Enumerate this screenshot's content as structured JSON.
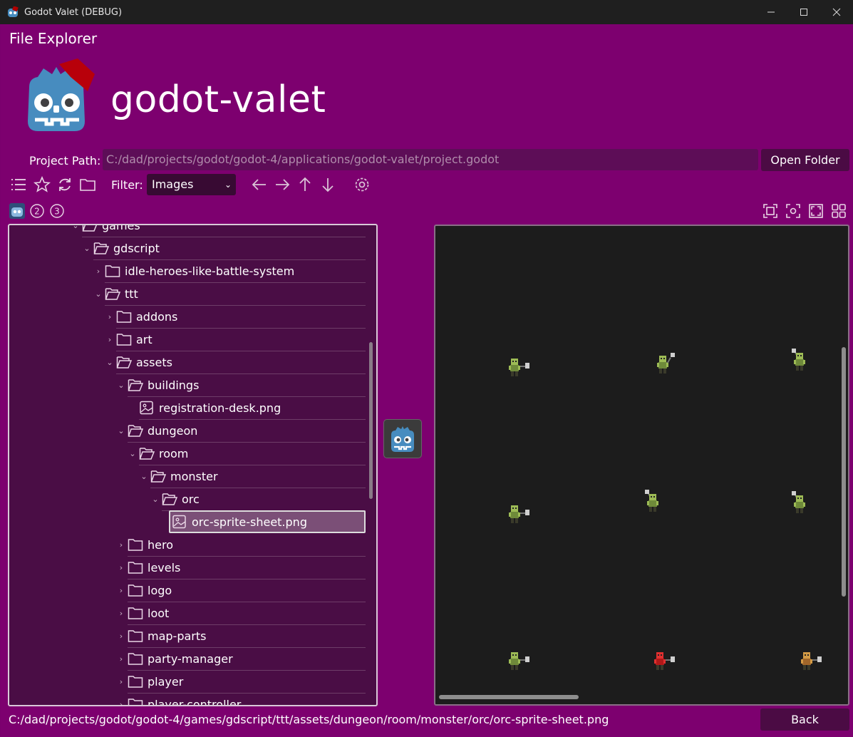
{
  "window": {
    "title": "Godot Valet (DEBUG)"
  },
  "header": {
    "section_title": "File Explorer",
    "app_name": "godot-valet"
  },
  "project": {
    "path_label": "Project Path:",
    "path_value": "C:/dad/projects/godot/godot-4/applications/godot-valet/project.godot",
    "open_folder_label": "Open Folder"
  },
  "toolbar": {
    "icons": [
      "list-icon",
      "star-icon",
      "refresh-icon",
      "folder-icon",
      "arrow-left-icon",
      "arrow-right-icon",
      "arrow-up-icon",
      "arrow-down-icon",
      "settings-icon"
    ],
    "filter_label": "Filter:",
    "filter_value": "Images"
  },
  "tabs": [
    "godot-icon",
    "2",
    "3"
  ],
  "tree": {
    "items": [
      {
        "label": "games",
        "depth": 5,
        "expanded": true,
        "type": "folder"
      },
      {
        "label": "gdscript",
        "depth": 6,
        "expanded": true,
        "type": "folder"
      },
      {
        "label": "idle-heroes-like-battle-system",
        "depth": 7,
        "expanded": false,
        "type": "folder"
      },
      {
        "label": "ttt",
        "depth": 7,
        "expanded": true,
        "type": "folder"
      },
      {
        "label": "addons",
        "depth": 8,
        "expanded": false,
        "type": "folder"
      },
      {
        "label": "art",
        "depth": 8,
        "expanded": false,
        "type": "folder"
      },
      {
        "label": "assets",
        "depth": 8,
        "expanded": true,
        "type": "folder"
      },
      {
        "label": "buildings",
        "depth": 9,
        "expanded": true,
        "type": "folder"
      },
      {
        "label": "registration-desk.png",
        "depth": 10,
        "type": "image"
      },
      {
        "label": "dungeon",
        "depth": 9,
        "expanded": true,
        "type": "folder"
      },
      {
        "label": "room",
        "depth": 10,
        "expanded": true,
        "type": "folder"
      },
      {
        "label": "monster",
        "depth": 11,
        "expanded": true,
        "type": "folder"
      },
      {
        "label": "orc",
        "depth": 12,
        "expanded": true,
        "type": "folder"
      },
      {
        "label": "orc-sprite-sheet.png",
        "depth": 13,
        "type": "image",
        "selected": true
      },
      {
        "label": "hero",
        "depth": 9,
        "expanded": false,
        "type": "folder"
      },
      {
        "label": "levels",
        "depth": 9,
        "expanded": false,
        "type": "folder"
      },
      {
        "label": "logo",
        "depth": 9,
        "expanded": false,
        "type": "folder"
      },
      {
        "label": "loot",
        "depth": 9,
        "expanded": false,
        "type": "folder"
      },
      {
        "label": "map-parts",
        "depth": 9,
        "expanded": false,
        "type": "folder"
      },
      {
        "label": "party-manager",
        "depth": 9,
        "expanded": false,
        "type": "folder"
      },
      {
        "label": "player",
        "depth": 9,
        "expanded": false,
        "type": "folder"
      },
      {
        "label": "player-controller",
        "depth": 9,
        "expanded": false,
        "type": "folder"
      }
    ]
  },
  "viewer_tools": [
    "fit-icon",
    "zoom-fit-icon",
    "fullscreen-icon",
    "grid-icon"
  ],
  "status": {
    "path": "C:/dad/projects/godot/godot-4/games/gdscript/ttt/assets/dungeon/room/monster/orc/orc-sprite-sheet.png",
    "back_label": "Back"
  },
  "colors": {
    "background": "#7d006f",
    "tree_bg": "#4a0d45",
    "viewer_bg": "#1c1c1c",
    "selection": "#7b4f77"
  }
}
